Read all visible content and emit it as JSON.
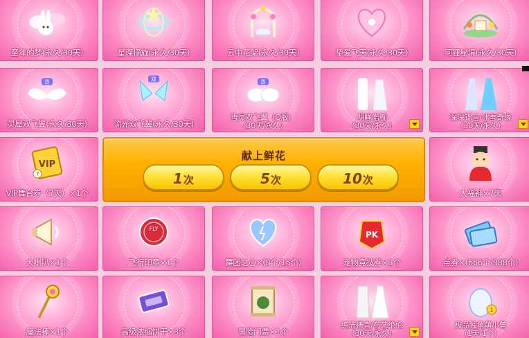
{
  "items": [
    {
      "label": "童年的梦(永久/30天)",
      "icon": "bunny-wings-icon",
      "more": false
    },
    {
      "label": "星璨摘旋(永久/30天)",
      "icon": "star-halo-icon",
      "more": false
    },
    {
      "label": "云中花架(永久/30天)",
      "icon": "flower-swing-icon",
      "more": false
    },
    {
      "label": "挚爱飞天(永久/30天)",
      "icon": "heart-wings-icon",
      "more": false
    },
    {
      "label": "阿狸秘境(永久/30天)",
      "icon": "fox-garden-icon",
      "more": false
    },
    {
      "label": "灵犀双飞翼(永久/30天)",
      "icon": "double-wings-icon",
      "more": false
    },
    {
      "label": "流光双飞翼(永久/30天)",
      "icon": "crystal-wings-icon",
      "more": false
    },
    {
      "label": "雪灵双飞翼（Q版）\n（30天/永久）",
      "icon": "snow-wings-icon",
      "more": false
    },
    {
      "label": "明眸皓腕\n（30天/永久）",
      "icon": "couple-outfit-icon",
      "more": true
    },
    {
      "label": "深深锦言/冰雪奇缘\n（30天/永久）",
      "icon": "ice-dress-icon",
      "more": true
    },
    {
      "label": "VIP舞台券（7天）×1个",
      "icon": "vip-ticket-icon",
      "more": false
    },
    {
      "label": "大福神×7天",
      "icon": "fortune-god-icon",
      "more": false
    },
    {
      "label": "大喇叭×1个",
      "icon": "megaphone-icon",
      "more": false
    },
    {
      "label": "飞行印章×1个",
      "icon": "flying-seal-icon",
      "more": false
    },
    {
      "label": "舞团之心×(8个/15个)",
      "icon": "heart-crystal-icon",
      "more": false
    },
    {
      "label": "宠物竞技券×3个",
      "icon": "pk-ticket-icon",
      "more": false
    },
    {
      "label": "点券×(666个/888个)",
      "icon": "coupon-icon",
      "more": false
    },
    {
      "label": "魔法棒×1个",
      "icon": "magic-wand-icon",
      "more": false
    },
    {
      "label": "高级浓缩饼干×3个",
      "icon": "biscuit-pack-icon",
      "more": false
    },
    {
      "label": "冒险门票×1个",
      "icon": "adventure-scroll-icon",
      "more": false
    },
    {
      "label": "纯洁祷言/布艺绝伦\n（30天/永久）",
      "icon": "wedding-outfit-icon",
      "more": true
    },
    {
      "label": "极品独角萌小兽\n（1天/1个）",
      "icon": "egg-icon",
      "more": false
    }
  ],
  "panel": {
    "title": "献上鲜花",
    "buttons": [
      {
        "num": "1",
        "unit": "次"
      },
      {
        "num": "5",
        "unit": "次"
      },
      {
        "num": "10",
        "unit": "次"
      }
    ]
  },
  "colors": {
    "cell": "#ff9fd0",
    "panel": "#ffb100",
    "button": "#ffe23a",
    "label_outline": "#b0105e"
  }
}
